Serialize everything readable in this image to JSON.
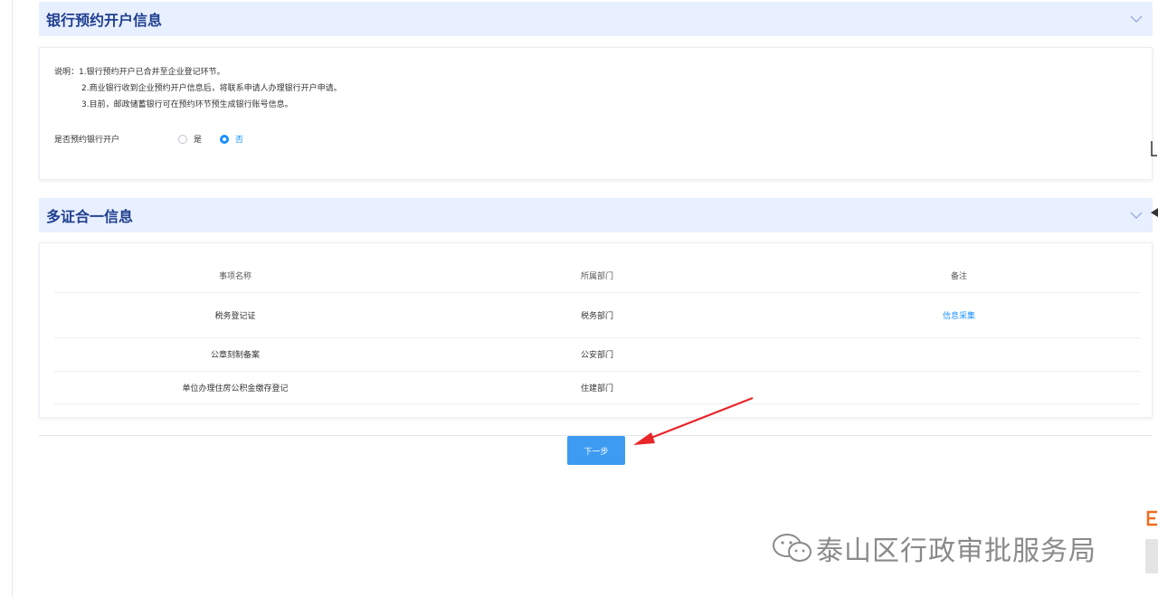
{
  "bank_section": {
    "title": "银行预约开户信息",
    "notes": {
      "prefix": "说明：",
      "line1": "1.银行预约开户已合并至企业登记环节。",
      "line2": "2.商业银行收到企业预约开户信息后，将联系申请人办理银行开户申请。",
      "line3": "3.目前，邮政储蓄银行可在预约环节预生成银行账号信息。"
    },
    "radio_label": "是否预约银行开户",
    "options": [
      {
        "label": "是",
        "selected": false
      },
      {
        "label": "否",
        "selected": true
      }
    ]
  },
  "multi_cert_section": {
    "title": "多证合一信息",
    "columns": [
      "事项名称",
      "所属部门",
      "备注"
    ],
    "rows": [
      {
        "name": "税务登记证",
        "dept": "税务部门",
        "note": "信息采集"
      },
      {
        "name": "公章刻制备案",
        "dept": "公安部门",
        "note": ""
      },
      {
        "name": "单位办理住房公积金缴存登记",
        "dept": "住建部门",
        "note": ""
      }
    ]
  },
  "next_button": "下一步",
  "watermark": "泰山区行政审批服务局",
  "colors": {
    "accent": "#1890ff",
    "header_bg": "#e8efff",
    "title": "#1f3f8f",
    "button": "#3e9bf2",
    "arrow": "#e8262a"
  },
  "icons": [
    "chevron-down-icon",
    "wechat-icon",
    "red-arrow-annotation"
  ]
}
